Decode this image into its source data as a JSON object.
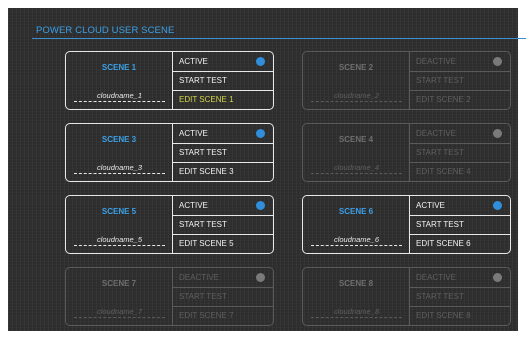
{
  "header": {
    "title": "POWER CLOUD USER SCENE"
  },
  "scenes": [
    {
      "name": "SCENE 1",
      "cloud": "cloudname_1",
      "status": "ACTIVE",
      "test": "START TEST",
      "edit": "EDIT SCENE 1"
    },
    {
      "name": "SCENE 2",
      "cloud": "cloudname_2",
      "status": "DEACTIVE",
      "test": "START TEST",
      "edit": "EDIT SCENE 2"
    },
    {
      "name": "SCENE 3",
      "cloud": "cloudname_3",
      "status": "ACTIVE",
      "test": "START TEST",
      "edit": "EDIT SCENE 3"
    },
    {
      "name": "SCENE 4",
      "cloud": "cloudname_4",
      "status": "DEACTIVE",
      "test": "START TEST",
      "edit": "EDIT SCENE 4"
    },
    {
      "name": "SCENE 5",
      "cloud": "cloudname_5",
      "status": "ACTIVE",
      "test": "START TEST",
      "edit": "EDIT SCENE 5"
    },
    {
      "name": "SCENE 6",
      "cloud": "cloudname_6",
      "status": "ACTIVE",
      "test": "START TEST",
      "edit": "EDIT SCENE 6"
    },
    {
      "name": "SCENE 7",
      "cloud": "cloudname_7",
      "status": "DEACTIVE",
      "test": "START TEST",
      "edit": "EDIT SCENE 7"
    },
    {
      "name": "SCENE 8",
      "cloud": "cloudname_8",
      "status": "DEACTIVE",
      "test": "START TEST",
      "edit": "EDIT SCENE 8"
    }
  ],
  "colors": {
    "accent": "#3aa0e8",
    "active_dot": "#2f8fdc",
    "inactive_dot": "#7a7a7a",
    "highlight_text": "#d6d64a",
    "panel_bg": "#2d2d2d"
  }
}
